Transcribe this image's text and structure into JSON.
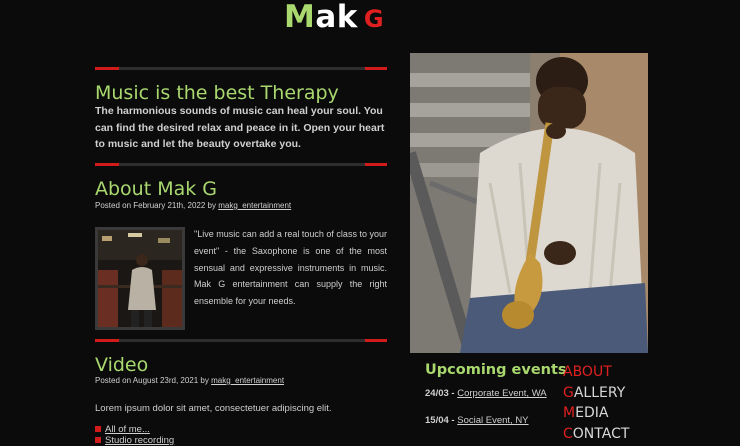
{
  "logo": {
    "m": "M",
    "ak": "ak",
    "g": "G"
  },
  "hero": {
    "title": "Music is the best Therapy",
    "text": "The harmonious sounds of music can heal your soul. You can find the desired relax and peace in it. Open your heart to music and let the beauty overtake you."
  },
  "about": {
    "title": "About Mak G",
    "posted": "Posted on February 21th, 2022 by",
    "author": "makg_entertainment",
    "quote": "\"Live music can add a real touch of class to your event\" - the Saxophone is one of the most sensual and expressive instruments in music. Mak G entertainment can supply the right ensemble for your needs."
  },
  "video": {
    "title": "Video",
    "posted": "Posted on August 23rd, 2021 by",
    "author": "makg_entertainment",
    "lorem": "Lorem ipsum dolor sit amet, consectetuer adipiscing elit.",
    "links": [
      "All of me...",
      "Studio recording"
    ]
  },
  "events": {
    "title": "Upcoming events",
    "items": [
      {
        "date": "24/03",
        "label": "Corporate Event, WA"
      },
      {
        "date": "15/04",
        "label": "Social Event, NY"
      }
    ]
  },
  "nav": {
    "about": {
      "first": "A",
      "rest": "BOUT"
    },
    "gallery": {
      "first": "G",
      "rest": "ALLERY"
    },
    "media": {
      "first": "M",
      "rest": "EDIA"
    },
    "contact": {
      "first": "C",
      "rest": "ONTACT"
    }
  },
  "colors": {
    "accent_green": "#a9d86e",
    "accent_red": "#d21b1b",
    "background": "#0b0b0b"
  }
}
